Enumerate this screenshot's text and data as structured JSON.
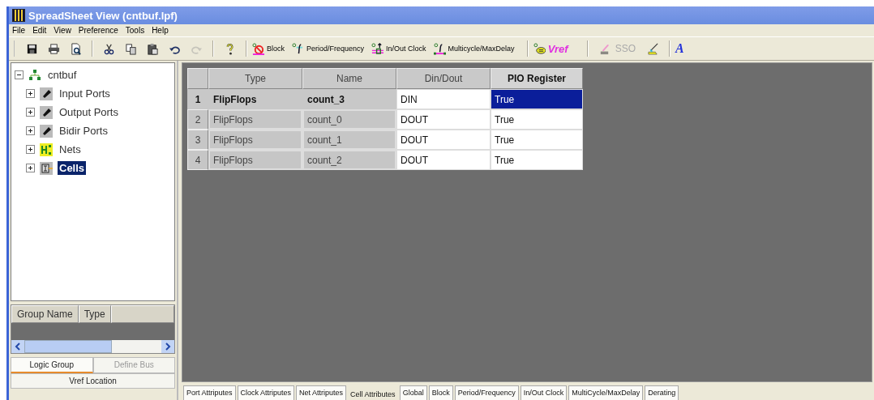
{
  "window": {
    "title": "SpreadSheet View (cntbuf.lpf)"
  },
  "menu": [
    "File",
    "Edit",
    "View",
    "Preference",
    "Tools",
    "Help"
  ],
  "toolbar": [
    {
      "kind": "icon",
      "disabled": false
    },
    {
      "kind": "icon",
      "disabled": false
    },
    {
      "kind": "icon",
      "disabled": false
    },
    {
      "kind": "sep"
    },
    {
      "kind": "icon",
      "disabled": false
    },
    {
      "kind": "icon",
      "disabled": false
    },
    {
      "kind": "icon",
      "disabled": false
    },
    {
      "kind": "icon",
      "disabled": false
    },
    {
      "kind": "icon",
      "disabled": true
    },
    {
      "kind": "sep"
    },
    {
      "kind": "icon",
      "disabled": false
    },
    {
      "kind": "sep"
    },
    {
      "kind": "labeled",
      "label": "Block"
    },
    {
      "kind": "labeled",
      "label": "Period/Frequency"
    },
    {
      "kind": "labeled",
      "label": "In/Out Clock"
    },
    {
      "kind": "labeled",
      "label": "Multicycle/MaxDelay"
    },
    {
      "kind": "sep"
    },
    {
      "kind": "vref",
      "label": "Vref"
    },
    {
      "kind": "sep"
    },
    {
      "kind": "icon",
      "disabled": false
    },
    {
      "kind": "text",
      "label": "SSO",
      "disabled": true
    },
    {
      "kind": "icon",
      "disabled": false
    },
    {
      "kind": "sep"
    },
    {
      "kind": "font",
      "label": "A"
    }
  ],
  "tree": {
    "label": "cntbuf",
    "expanded": true,
    "selected": false,
    "children": [
      {
        "label": "Input Ports",
        "expanded": false,
        "selected": false
      },
      {
        "label": "Output Ports",
        "expanded": false,
        "selected": false
      },
      {
        "label": "Bidir Ports",
        "expanded": false,
        "selected": false
      },
      {
        "label": "Nets",
        "expanded": false,
        "selected": false
      },
      {
        "label": "Cells",
        "expanded": false,
        "selected": true
      }
    ]
  },
  "group_table": {
    "columns": [
      "Group Name",
      "Type"
    ]
  },
  "left_tabs": [
    {
      "label": "Logic Group",
      "selected": true,
      "disabled": false
    },
    {
      "label": "Define Bus",
      "selected": false,
      "disabled": true
    },
    {
      "label": "Vref Location",
      "selected": false,
      "disabled": false
    }
  ],
  "table": {
    "columns": [
      {
        "label": "Type",
        "selected": false
      },
      {
        "label": "Name",
        "selected": false
      },
      {
        "label": "Din/Dout",
        "selected": false
      },
      {
        "label": "PIO Register",
        "selected": true
      }
    ],
    "rows": [
      {
        "index": "1",
        "selected": true,
        "cells": [
          {
            "text": "FlipFlops",
            "selected": false
          },
          {
            "text": "count_3",
            "selected": false
          },
          {
            "text": "DIN",
            "selected": false
          },
          {
            "text": "True",
            "selected": true
          }
        ]
      },
      {
        "index": "2",
        "selected": false,
        "cells": [
          {
            "text": "FlipFlops",
            "selected": false
          },
          {
            "text": "count_0",
            "selected": false
          },
          {
            "text": "DOUT",
            "selected": false
          },
          {
            "text": "True",
            "selected": false
          }
        ]
      },
      {
        "index": "3",
        "selected": false,
        "cells": [
          {
            "text": "FlipFlops",
            "selected": false
          },
          {
            "text": "count_1",
            "selected": false
          },
          {
            "text": "DOUT",
            "selected": false
          },
          {
            "text": "True",
            "selected": false
          }
        ]
      },
      {
        "index": "4",
        "selected": false,
        "cells": [
          {
            "text": "FlipFlops",
            "selected": false
          },
          {
            "text": "count_2",
            "selected": false
          },
          {
            "text": "DOUT",
            "selected": false
          },
          {
            "text": "True",
            "selected": false
          }
        ]
      }
    ]
  },
  "bottom_tabs": [
    {
      "label": "Port Attriputes",
      "selected": false
    },
    {
      "label": "Clock Attriputes",
      "selected": false
    },
    {
      "label": "Net Attriputes",
      "selected": false
    },
    {
      "label": "Cell Attributes",
      "selected": true
    },
    {
      "label": "Global",
      "selected": false
    },
    {
      "label": "Block",
      "selected": false
    },
    {
      "label": "Period/Frequency",
      "selected": false
    },
    {
      "label": "In/Out Clock",
      "selected": false
    },
    {
      "label": "MultiCycle/MaxDelay",
      "selected": false
    },
    {
      "label": "Derating",
      "selected": false
    }
  ]
}
